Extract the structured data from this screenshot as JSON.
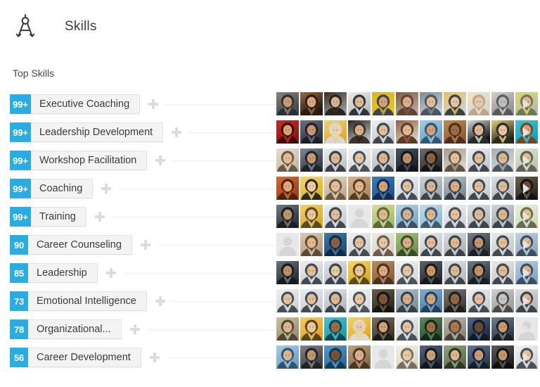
{
  "header": {
    "icon": "compass-icon",
    "title": "Skills"
  },
  "section": {
    "heading": "Top Skills"
  },
  "colors": {
    "badge_blue": "#2BACE2",
    "pill_bg": "#F4F4F4",
    "pill_border": "#E2E2E2",
    "text": "#3a3a3a",
    "connector": "#EDEDED",
    "arrow": "#E3E3E3",
    "background": "#ffffff"
  },
  "skills": [
    {
      "count": "99+",
      "name": "Executive Coaching",
      "add_label": "+",
      "next_label": "▶",
      "endorser_count": 11,
      "endorsers": [
        {
          "type": "photo",
          "c1": "#40454d",
          "c2": "#8c8276",
          "c3": "#2b2f36",
          "skin": "#c99a74"
        },
        {
          "type": "photo",
          "c1": "#1b1410",
          "c2": "#9a6a3c",
          "c3": "#2a1d14",
          "skin": "#d8a57c"
        },
        {
          "type": "photo",
          "c1": "#9a9a96",
          "c2": "#3a2c24",
          "c3": "#242424",
          "skin": "#d9b193"
        },
        {
          "type": "photo",
          "c1": "#b9bcc0",
          "c2": "#f0e9e2",
          "c3": "#2f3640",
          "skin": "#e0b894"
        },
        {
          "type": "photo",
          "c1": "#e8c220",
          "c2": "#d9b52c",
          "c3": "#3d4250",
          "skin": "#cfa17a"
        },
        {
          "type": "photo",
          "c1": "#b6a79a",
          "c2": "#7d5b43",
          "c3": "#5e4436",
          "skin": "#dcae87"
        },
        {
          "type": "photo",
          "c1": "#c9cdd2",
          "c2": "#7b8b96",
          "c3": "#4a5560",
          "skin": "#e3bc99"
        },
        {
          "type": "photo",
          "c1": "#cfd3d8",
          "c2": "#e3c25a",
          "c3": "#3c4148",
          "skin": "#e6c3a0"
        },
        {
          "type": "photo",
          "c1": "#d9d4cd",
          "c2": "#efe2c6",
          "c3": "#b7a894",
          "skin": "#e8c7a4"
        },
        {
          "type": "photo",
          "c1": "#8f8f8f",
          "c2": "#cfcfcf",
          "c3": "#5a5a5a",
          "skin": "#bdbdbd"
        },
        {
          "type": "photo",
          "c1": "#b7bfa8",
          "c2": "#e0d474",
          "c3": "#6f7a55",
          "skin": "#dfb68c"
        }
      ]
    },
    {
      "count": "99+",
      "name": "Leadership Development",
      "add_label": "+",
      "next_label": "▶",
      "endorser_count": 11,
      "endorsers": [
        {
          "type": "photo",
          "c1": "#8e1414",
          "c2": "#c62b22",
          "c3": "#3a0d0d",
          "skin": "#d8a178"
        },
        {
          "type": "photo",
          "c1": "#2b3038",
          "c2": "#6b7480",
          "c3": "#1d2026",
          "skin": "#c8966f"
        },
        {
          "type": "photo",
          "c1": "#e0a828",
          "c2": "#f0d07a",
          "c3": "#d8d8d8",
          "skin": "#ecd3b0"
        },
        {
          "type": "photo",
          "c1": "#b8bcc0",
          "c2": "#2a2420",
          "c3": "#3b332c",
          "skin": "#d8ae88"
        },
        {
          "type": "photo",
          "c1": "#c2c6ca",
          "c2": "#eceff1",
          "c3": "#3f4651",
          "skin": "#e1bd9a"
        },
        {
          "type": "photo",
          "c1": "#d6d1c8",
          "c2": "#8f5f3f",
          "c3": "#5c3d2a",
          "skin": "#e3b68e"
        },
        {
          "type": "photo",
          "c1": "#6f9dc4",
          "c2": "#9fd0ea",
          "c3": "#35566f",
          "skin": "#d0a17b"
        },
        {
          "type": "photo",
          "c1": "#8a5a38",
          "c2": "#c08a52",
          "c3": "#4b2f1c",
          "skin": "#9a6b44"
        },
        {
          "type": "photo",
          "c1": "#101010",
          "c2": "#d8d8d8",
          "c3": "#2a2a2a",
          "skin": "#dcb68f"
        },
        {
          "type": "photo",
          "c1": "#1c1c1c",
          "c2": "#e4d07a",
          "c3": "#2e2a22",
          "skin": "#e5c49f"
        },
        {
          "type": "photo",
          "c1": "#17a0b4",
          "c2": "#3fc2d4",
          "c3": "#6e4a2c",
          "skin": "#d2a178"
        }
      ]
    },
    {
      "count": "99+",
      "name": "Workshop Facilitation",
      "add_label": "+",
      "next_label": "▶",
      "endorser_count": 11,
      "endorsers": [
        {
          "type": "photo",
          "c1": "#c8b9a4",
          "c2": "#e8dcc8",
          "c3": "#6b5a46",
          "skin": "#e2bd95"
        },
        {
          "type": "photo",
          "c1": "#2f3742",
          "c2": "#7d8894",
          "c3": "#1e242c",
          "skin": "#c9996f"
        },
        {
          "type": "photo",
          "c1": "#bfc4c8",
          "c2": "#e9ecee",
          "c3": "#3a4048",
          "skin": "#dfb892"
        },
        {
          "type": "photo",
          "c1": "#d6d9dc",
          "c2": "#f2f4f5",
          "c3": "#4a5158",
          "skin": "#e7c6a3"
        },
        {
          "type": "photo",
          "c1": "#b4b8bc",
          "c2": "#dfe3e6",
          "c3": "#394049",
          "skin": "#dcb58d"
        },
        {
          "type": "photo",
          "c1": "#1a1f28",
          "c2": "#4a5564",
          "c3": "#12161c",
          "skin": "#c08f66"
        },
        {
          "type": "photo",
          "c1": "#2a2a2a",
          "c2": "#6e6e6e",
          "c3": "#151515",
          "skin": "#8a6343"
        },
        {
          "type": "photo",
          "c1": "#d8d4cd",
          "c2": "#aa9b88",
          "c3": "#5e5346",
          "skin": "#e3c09b"
        },
        {
          "type": "photo",
          "c1": "#c4c8cb",
          "c2": "#ecedef",
          "c3": "#404750",
          "skin": "#e0bb96"
        },
        {
          "type": "photo",
          "c1": "#cfd3d6",
          "c2": "#a8aeb4",
          "c3": "#4d545c",
          "skin": "#ddb88f"
        },
        {
          "type": "photo",
          "c1": "#b9c2ae",
          "c2": "#e2e6d4",
          "c3": "#5c6650",
          "skin": "#e1bb93"
        }
      ]
    },
    {
      "count": "99+",
      "name": "Coaching",
      "add_label": "+",
      "next_label": "▶",
      "endorser_count": 11,
      "endorsers": [
        {
          "type": "photo",
          "c1": "#a83a18",
          "c2": "#d96a2c",
          "c3": "#4a2410",
          "skin": "#dfa97c"
        },
        {
          "type": "photo",
          "c1": "#e0b020",
          "c2": "#f2d872",
          "c3": "#2e2a1e",
          "skin": "#eacaa4"
        },
        {
          "type": "photo",
          "c1": "#c0a98e",
          "c2": "#e6d7bf",
          "c3": "#6a5840",
          "skin": "#e5c09a"
        },
        {
          "type": "photo",
          "c1": "#b08a5e",
          "c2": "#d9b387",
          "c3": "#54402a",
          "skin": "#e0b58c"
        },
        {
          "type": "photo",
          "c1": "#1f4f8f",
          "c2": "#3f7cc0",
          "c3": "#14294a",
          "skin": "#d2a37c"
        },
        {
          "type": "photo",
          "c1": "#cfd4d8",
          "c2": "#eef1f3",
          "c3": "#454c55",
          "skin": "#e4c09d"
        },
        {
          "type": "photo",
          "c1": "#9aa4ac",
          "c2": "#ccd3d8",
          "c3": "#3b434c",
          "skin": "#dab48c"
        },
        {
          "type": "photo",
          "c1": "#7c8590",
          "c2": "#b8c0c8",
          "c3": "#343b44",
          "skin": "#d7ae85"
        },
        {
          "type": "photo",
          "c1": "#c8cbce",
          "c2": "#eceeef",
          "c3": "#414850",
          "skin": "#e2bd98"
        },
        {
          "type": "photo",
          "c1": "#b0b6bb",
          "c2": "#dde1e4",
          "c3": "#3e454d",
          "skin": "#debb93"
        },
        {
          "type": "photo",
          "c1": "#2a2622",
          "c2": "#6d5f4e",
          "c3": "#171513",
          "skin": "#6b4a30"
        }
      ]
    },
    {
      "count": "99+",
      "name": "Training",
      "add_label": "+",
      "next_label": "▶",
      "endorser_count": 11,
      "endorsers": [
        {
          "type": "photo",
          "c1": "#2b3038",
          "c2": "#717a86",
          "c3": "#1b1f25",
          "skin": "#c2916a"
        },
        {
          "type": "photo",
          "c1": "#d8a82a",
          "c2": "#f0d06e",
          "c3": "#5c4a1e",
          "skin": "#e7c59d"
        },
        {
          "type": "photo",
          "c1": "#c9ccd0",
          "c2": "#ecedef",
          "c3": "#414850",
          "skin": "#e0bb96"
        },
        {
          "type": "placeholder"
        },
        {
          "type": "photo",
          "c1": "#a8b86a",
          "c2": "#d4e09a",
          "c3": "#5c6a38",
          "skin": "#ddb78f"
        },
        {
          "type": "photo",
          "c1": "#7fa8c8",
          "c2": "#b6d4e6",
          "c3": "#3a5266",
          "skin": "#d9b18a"
        },
        {
          "type": "photo",
          "c1": "#8fb8d6",
          "c2": "#c4dcec",
          "c3": "#405a6e",
          "skin": "#dcb68e"
        },
        {
          "type": "photo",
          "c1": "#d0d4d7",
          "c2": "#eff1f2",
          "c3": "#4a515a",
          "skin": "#e5c29e"
        },
        {
          "type": "photo",
          "c1": "#b2b8bd",
          "c2": "#dee2e5",
          "c3": "#3e454e",
          "skin": "#debb93"
        },
        {
          "type": "photo",
          "c1": "#9da6ae",
          "c2": "#cfd5da",
          "c3": "#3a424a",
          "skin": "#dab48c"
        },
        {
          "type": "photo",
          "c1": "#cfd8b8",
          "c2": "#eaf0d6",
          "c3": "#66704e",
          "skin": "#e3bd95"
        }
      ]
    },
    {
      "count": "90",
      "name": "Career Counseling",
      "add_label": "+",
      "next_label": "▶",
      "endorser_count": 11,
      "endorsers": [
        {
          "type": "placeholder"
        },
        {
          "type": "photo",
          "c1": "#b49a80",
          "c2": "#ddc9b0",
          "c3": "#5e4a36",
          "skin": "#e0b98f"
        },
        {
          "type": "photo",
          "c1": "#1d4f7a",
          "c2": "#3a79a8",
          "c3": "#12293f",
          "skin": "#8a6040"
        },
        {
          "type": "photo",
          "c1": "#cdd1d4",
          "c2": "#eef0f1",
          "c3": "#454c54",
          "skin": "#e3c09c"
        },
        {
          "type": "photo",
          "c1": "#d7d2c8",
          "c2": "#f0ebe0",
          "c3": "#6a5e4e",
          "skin": "#e6c5a1"
        },
        {
          "type": "photo",
          "c1": "#6e8f4e",
          "c2": "#a8c47e",
          "c3": "#3a4c28",
          "skin": "#d6ad84"
        },
        {
          "type": "photo",
          "c1": "#c2c6c9",
          "c2": "#e8eaeb",
          "c3": "#3f464e",
          "skin": "#e0bb96"
        },
        {
          "type": "photo",
          "c1": "#aeb4ba",
          "c2": "#dadee2",
          "c3": "#3b424a",
          "skin": "#ddb890"
        },
        {
          "type": "photo",
          "c1": "#2e3640",
          "c2": "#76808c",
          "c3": "#1c2127",
          "skin": "#c6946c"
        },
        {
          "type": "photo",
          "c1": "#c5c9cc",
          "c2": "#eaecee",
          "c3": "#424950",
          "skin": "#e1bd98"
        },
        {
          "type": "photo",
          "c1": "#8fa8c0",
          "c2": "#c2d4e2",
          "c3": "#3c4e60",
          "skin": "#dab68e"
        }
      ]
    },
    {
      "count": "85",
      "name": "Leadership",
      "add_label": "+",
      "next_label": "▶",
      "endorser_count": 11,
      "endorsers": [
        {
          "type": "photo",
          "c1": "#262c34",
          "c2": "#6b7481",
          "c3": "#171b21",
          "skin": "#c08e66"
        },
        {
          "type": "photo",
          "c1": "#c8ccd0",
          "c2": "#edeef0",
          "c3": "#434a52",
          "skin": "#e1bc97"
        },
        {
          "type": "photo",
          "c1": "#b8bcc0",
          "c2": "#e2e5e8",
          "c3": "#3c434b",
          "skin": "#decd9a"
        },
        {
          "type": "photo",
          "c1": "#e0a820",
          "c2": "#f4d66a",
          "c3": "#5e4a18",
          "skin": "#e8c79f"
        },
        {
          "type": "photo",
          "c1": "#8a5c38",
          "c2": "#bd8d5c",
          "c3": "#4a3020",
          "skin": "#d9ab80"
        },
        {
          "type": "photo",
          "c1": "#d4d8db",
          "c2": "#f1f3f4",
          "c3": "#4c535b",
          "skin": "#e6c49f"
        },
        {
          "type": "photo",
          "c1": "#2a2a2e",
          "c2": "#5e6269",
          "c3": "#16181c",
          "skin": "#c7985f"
        },
        {
          "type": "photo",
          "c1": "#b6bcc2",
          "c2": "#dfe3e7",
          "c3": "#3d444c",
          "skin": "#ddb990"
        },
        {
          "type": "photo",
          "c1": "#2c323a",
          "c2": "#727b87",
          "c3": "#1a1e24",
          "skin": "#c3926a"
        },
        {
          "type": "photo",
          "c1": "#c0c4c8",
          "c2": "#e9ebed",
          "c3": "#414850",
          "skin": "#e0bb96"
        },
        {
          "type": "photo",
          "c1": "#7fa4c6",
          "c2": "#b8d2e4",
          "c3": "#3a4f64",
          "skin": "#d8b08a"
        }
      ]
    },
    {
      "count": "73",
      "name": "Emotional Intelligence",
      "add_label": "+",
      "next_label": "▶",
      "endorser_count": 11,
      "endorsers": [
        {
          "type": "photo",
          "c1": "#cfd2d5",
          "c2": "#eef0f1",
          "c3": "#474e56",
          "skin": "#e4c19d"
        },
        {
          "type": "photo",
          "c1": "#c8ccd0",
          "c2": "#ebedee",
          "c3": "#434a52",
          "skin": "#e1bd98"
        },
        {
          "type": "photo",
          "c1": "#b6bac0",
          "c2": "#dfe2e6",
          "c3": "#3d444c",
          "skin": "#ddb990"
        },
        {
          "type": "photo",
          "c1": "#d8dadc",
          "c2": "#f2f3f4",
          "c3": "#4e555d",
          "skin": "#e7c6a2"
        },
        {
          "type": "photo",
          "c1": "#2a2520",
          "c2": "#6b5c4a",
          "c3": "#171410",
          "skin": "#7a5536"
        },
        {
          "type": "photo",
          "c1": "#7c8d9c",
          "c2": "#b4c2cd",
          "c3": "#36414c",
          "skin": "#d5ac84"
        },
        {
          "type": "photo",
          "c1": "#4a7ba8",
          "c2": "#82aece",
          "c3": "#24415c",
          "skin": "#d2a57e"
        },
        {
          "type": "photo",
          "c1": "#3c3a36",
          "c2": "#7e7a72",
          "c3": "#201e1c",
          "skin": "#8f6743"
        },
        {
          "type": "photo",
          "c1": "#cacdd0",
          "c2": "#eceef0",
          "c3": "#444b53",
          "skin": "#e2be99"
        },
        {
          "type": "photo",
          "c1": "#9a9a9a",
          "c2": "#d0d0d0",
          "c3": "#4a4a4a",
          "skin": "#c4c4c4"
        },
        {
          "type": "photo",
          "c1": "#b2b6ba",
          "c2": "#dcdfe2",
          "c3": "#3c434a",
          "skin": "#dcb891"
        }
      ]
    },
    {
      "count": "78",
      "name": "Organizational...",
      "add_label": "+",
      "next_label": "▶",
      "endorser_count": 11,
      "endorsers": [
        {
          "type": "photo",
          "c1": "#9a8c6e",
          "c2": "#cfc0a0",
          "c3": "#4e4636",
          "skin": "#dfb68e"
        },
        {
          "type": "photo",
          "c1": "#e0a022",
          "c2": "#f2cc68",
          "c3": "#5a4418",
          "skin": "#e9c89f"
        },
        {
          "type": "photo",
          "c1": "#1a9aa8",
          "c2": "#4cc0cc",
          "c3": "#0e4a52",
          "skin": "#9a6b45"
        },
        {
          "type": "photo",
          "c1": "#e6a418",
          "c2": "#f6d46c",
          "c3": "#d8d8d8",
          "skin": "#ebcaa2"
        },
        {
          "type": "photo",
          "c1": "#3a322a",
          "c2": "#7c6f5e",
          "c3": "#1e1a16",
          "skin": "#d0a179"
        },
        {
          "type": "photo",
          "c1": "#cfd2d4",
          "c2": "#eff0f1",
          "c3": "#4a515a",
          "skin": "#e5c3a0"
        },
        {
          "type": "photo",
          "c1": "#2b4a2c",
          "c2": "#5c8a5e",
          "c3": "#16281a",
          "skin": "#9c6f4a"
        },
        {
          "type": "photo",
          "c1": "#8a8278",
          "c2": "#c0b8ac",
          "c3": "#46403a",
          "skin": "#a8784e"
        },
        {
          "type": "photo",
          "c1": "#1e2a3a",
          "c2": "#4e6a8a",
          "c3": "#121a26",
          "skin": "#6b4830"
        },
        {
          "type": "photo",
          "c1": "#2c3440",
          "c2": "#74808f",
          "c3": "#1a1f27",
          "skin": "#c9986f"
        },
        {
          "type": "placeholder"
        }
      ]
    },
    {
      "count": "56",
      "name": "Career Development",
      "add_label": "+",
      "next_label": "▶",
      "endorser_count": 11,
      "endorsers": [
        {
          "type": "photo",
          "c1": "#6e9ec4",
          "c2": "#a8cde6",
          "c3": "#36536c",
          "skin": "#dcb58d"
        },
        {
          "type": "photo",
          "c1": "#3a3c40",
          "c2": "#82868c",
          "c3": "#202226",
          "skin": "#c09670"
        },
        {
          "type": "photo",
          "c1": "#2a6a9a",
          "c2": "#5a9ac8",
          "c3": "#163a56",
          "skin": "#7a5232"
        },
        {
          "type": "photo",
          "c1": "#8a6a4a",
          "c2": "#c0a080",
          "c3": "#4a3826",
          "skin": "#d9b089"
        },
        {
          "type": "placeholder"
        },
        {
          "type": "photo",
          "c1": "#dcd6c8",
          "c2": "#f4f0e6",
          "c3": "#7a6e5c",
          "skin": "#e8c9a6"
        },
        {
          "type": "photo",
          "c1": "#1e2836",
          "c2": "#526680",
          "c3": "#121820",
          "skin": "#ceA07a"
        },
        {
          "type": "photo",
          "c1": "#5a6a4a",
          "c2": "#94a480",
          "c3": "#2e3626",
          "skin": "#dcb68e"
        },
        {
          "type": "photo",
          "c1": "#28384c",
          "c2": "#5e7894",
          "c3": "#161e2a",
          "skin": "#cb9c72"
        },
        {
          "type": "photo",
          "c1": "#1c1c1e",
          "c2": "#5a5a60",
          "c3": "#101012",
          "skin": "#c29268"
        },
        {
          "type": "photo",
          "c1": "#cfd3d6",
          "c2": "#f0f2f3",
          "c3": "#4a525a",
          "skin": "#e4c09d"
        }
      ]
    }
  ]
}
